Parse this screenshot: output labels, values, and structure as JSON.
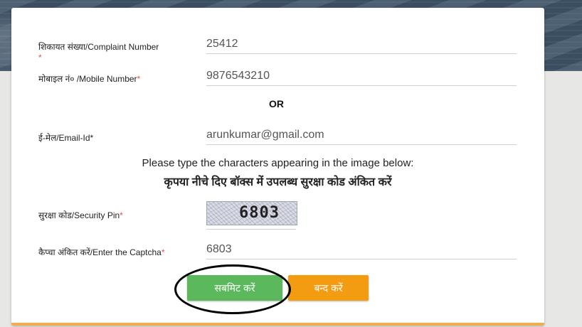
{
  "form": {
    "complaint": {
      "label": "शिकायत संख्या/Complaint Number",
      "required_mark": "*",
      "value": "25412"
    },
    "mobile": {
      "label": "मोबाइल नं० /Mobile Number",
      "required_mark": "*",
      "value": "9876543210"
    },
    "or_text": "OR",
    "email": {
      "label": "ई-मेल/Email-Id*",
      "value": "arunkumar@gmail.com"
    },
    "instruction_en": "Please type the characters appearing in the image below:",
    "instruction_hi": "कृपया नीचे दिए बॉक्स में उपलब्ध सुरक्षा कोड अंकित करें",
    "security_pin": {
      "label": "सुरक्षा कोड/Security Pin",
      "required_mark": "*",
      "captcha_text": "6803"
    },
    "captcha_entry": {
      "label": "कैप्चा अंकित करें/Enter the Captcha",
      "required_mark": "*",
      "value": "6803"
    },
    "submit_label": "सबमिट करें",
    "close_label": "बन्द करें"
  },
  "colors": {
    "submit": "#5cb85c",
    "close": "#f39c12",
    "required": "#d9534f"
  }
}
